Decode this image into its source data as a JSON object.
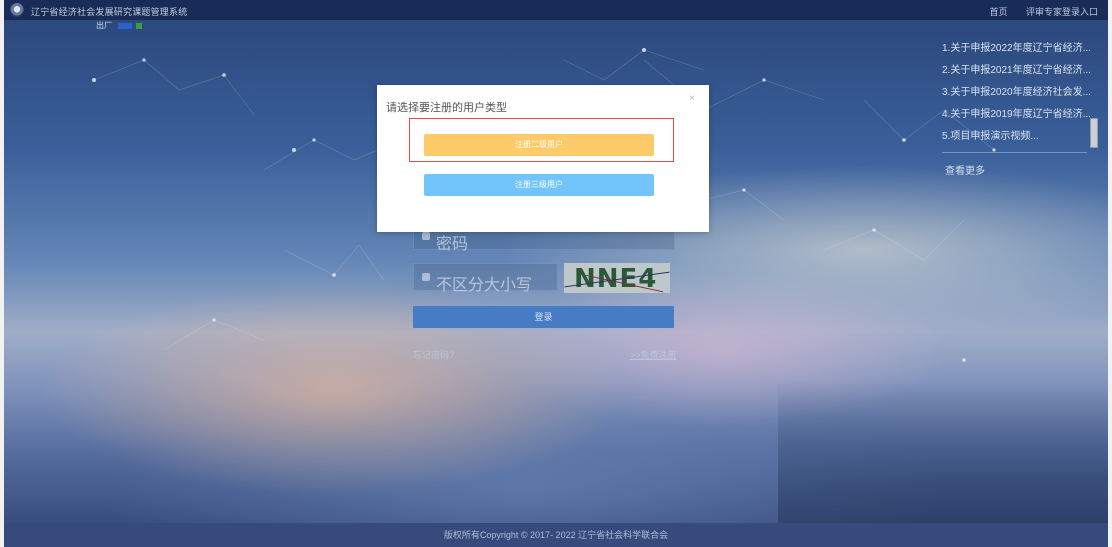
{
  "topbar": {
    "app_title": "辽宁省经济社会发展研究课题管理系统",
    "links": [
      "首页",
      "评审专家登录入口"
    ]
  },
  "mini_menu": {
    "label": "出厂"
  },
  "news": {
    "items": [
      "1.关于申报2022年度辽宁省经济...",
      "2.关于申报2021年度辽宁省经济...",
      "3.关于申报2020年度经济社会发...",
      "4.关于申报2019年度辽宁省经济...",
      "5.项目申报演示视频..."
    ],
    "more_label": "查看更多"
  },
  "login": {
    "password_placeholder": "密码",
    "captcha_placeholder": "不区分大小写",
    "captcha_text": "NNE4",
    "login_button": "登录",
    "forgot_link": "忘记密码?",
    "register_link": ">>免费注册"
  },
  "modal": {
    "title": "请选择要注册的用户类型",
    "close_label": "×",
    "btn_level2": "注册二级用户",
    "btn_level3": "注册三级用户"
  },
  "footer": {
    "copyright": "版权所有Copyright © 2017- 2022 辽宁省社会科学联合会"
  },
  "colors": {
    "topbar": "#1b2f5c",
    "level2_button": "#fdcb69",
    "level3_button": "#72c5fb",
    "highlight_border": "#e24b4b",
    "login_button": "#4a83cf"
  }
}
